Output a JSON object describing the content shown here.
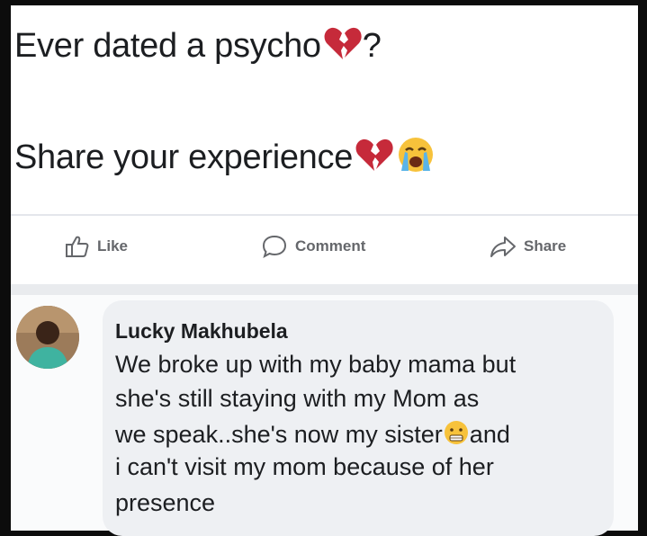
{
  "post": {
    "line1_text": "Ever dated a psycho",
    "line1_suffix": "?",
    "line1_emoji": "broken-heart-icon",
    "line2_text": "Share your experience",
    "line2_emojis": [
      "broken-heart-icon",
      "loudly-crying-face-icon"
    ]
  },
  "actions": {
    "like_label": "Like",
    "comment_label": "Comment",
    "share_label": "Share"
  },
  "comment": {
    "author": "Lucky Makhubela",
    "lines": [
      "We broke up with my baby mama but",
      "she's still staying with my Mom as",
      "we speak..she's now my sister",
      "i can't visit my mom because of her",
      "presence"
    ],
    "line3_after_emoji": "and",
    "inline_emoji": "grimacing-face-icon"
  },
  "colors": {
    "text": "#1c1e21",
    "muted": "#65676b",
    "bubble": "#eef0f3",
    "broken_heart": "#c62a3a"
  }
}
